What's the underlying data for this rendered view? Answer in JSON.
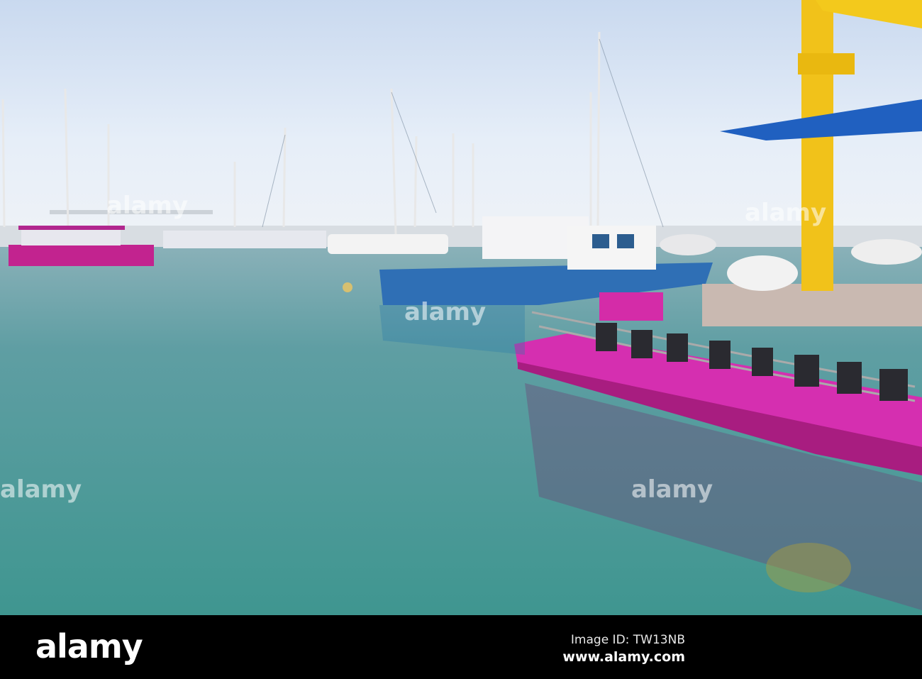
{
  "photo": {
    "subject": "marina-with-pink-tour-boat",
    "colors": {
      "sky": "#dfe8f5",
      "water": "#4f9a98",
      "pink": "#c8259e",
      "blue": "#2f6fb5",
      "crane": "#f1c21a"
    }
  },
  "footer": {
    "logo": "alamy",
    "image_id": "Image ID: TW13NB",
    "website": "www.alamy.com"
  },
  "watermark": "alamy"
}
